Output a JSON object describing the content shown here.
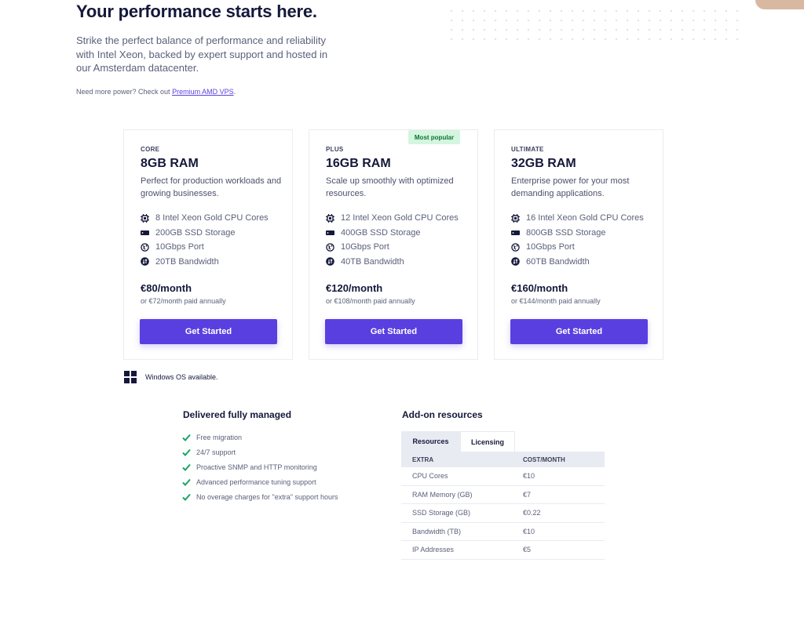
{
  "hero": {
    "title": "Your performance starts here.",
    "subtitle": "Strike the perfect balance of performance and reliability with Intel Xeon, backed by expert support and hosted in our Amsterdam datacenter.",
    "more_prefix": "Need more power? Check out ",
    "more_link": "Premium AMD VPS",
    "more_suffix": "."
  },
  "plans": [
    {
      "tier": "CORE",
      "ram": "8GB RAM",
      "description": "Perfect for production workloads and growing businesses.",
      "specs": [
        {
          "icon": "cpu-icon",
          "text": "8 Intel Xeon Gold CPU Cores"
        },
        {
          "icon": "ssd-icon",
          "text": "200GB SSD Storage"
        },
        {
          "icon": "globe-icon",
          "text": "10Gbps Port"
        },
        {
          "icon": "bandwidth-icon",
          "text": "20TB Bandwidth"
        }
      ],
      "price": "€80/month",
      "annual": "or €72/month paid annually",
      "button": "Get Started"
    },
    {
      "tier": "PLUS",
      "badge": "Most popular",
      "ram": "16GB RAM",
      "description": "Scale up smoothly with optimized resources.",
      "specs": [
        {
          "icon": "cpu-icon",
          "text": "12 Intel Xeon Gold CPU Cores"
        },
        {
          "icon": "ssd-icon",
          "text": "400GB SSD Storage"
        },
        {
          "icon": "globe-icon",
          "text": "10Gbps Port"
        },
        {
          "icon": "bandwidth-icon",
          "text": "40TB Bandwidth"
        }
      ],
      "price": "€120/month",
      "annual": "or €108/month paid annually",
      "button": "Get Started"
    },
    {
      "tier": "ULTIMATE",
      "ram": "32GB RAM",
      "description": "Enterprise power for your most demanding applications.",
      "specs": [
        {
          "icon": "cpu-icon",
          "text": "16 Intel Xeon Gold CPU Cores"
        },
        {
          "icon": "ssd-icon",
          "text": "800GB SSD Storage"
        },
        {
          "icon": "globe-icon",
          "text": "10Gbps Port"
        },
        {
          "icon": "bandwidth-icon",
          "text": "60TB Bandwidth"
        }
      ],
      "price": "€160/month",
      "annual": "or €144/month paid annually",
      "button": "Get Started"
    }
  ],
  "windows_note": "Windows OS available.",
  "managed": {
    "title": "Delivered fully managed",
    "items": [
      "Free migration",
      "24/7 support",
      "Proactive SNMP and HTTP monitoring",
      "Advanced performance tuning support",
      "No overage charges for \"extra\" support hours"
    ]
  },
  "addons": {
    "title": "Add-on resources",
    "tabs": [
      "Resources",
      "Licensing"
    ],
    "columns": [
      "EXTRA",
      "COST/MONTH"
    ],
    "rows": [
      [
        "CPU Cores",
        "€10"
      ],
      [
        "RAM Memory (GB)",
        "€7"
      ],
      [
        "SSD Storage (GB)",
        "€0.22"
      ],
      [
        "Bandwidth (TB)",
        "€10"
      ],
      [
        "IP Addresses",
        "€5"
      ]
    ]
  },
  "colors": {
    "accent": "#5a3fe0",
    "heading": "#14183a",
    "body_text": "#5b607a",
    "badge_bg": "#d4f5de",
    "check": "#1aa564"
  }
}
